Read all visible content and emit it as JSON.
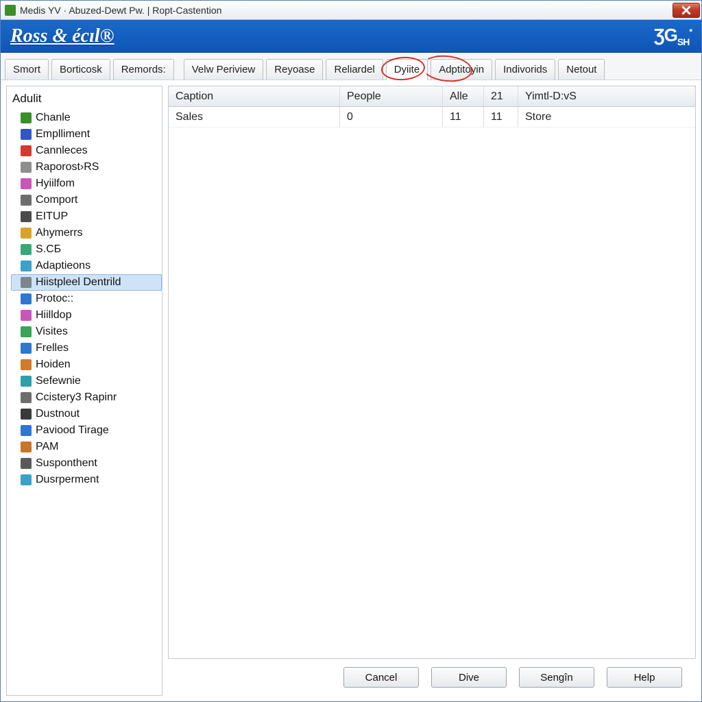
{
  "window": {
    "title": "Medis YV · Abuzed-Dewt Pw. | Ropt-Castention"
  },
  "brand": {
    "name": "Ross & écıl®",
    "logo_main": "ƷG",
    "logo_sub": "SH",
    "logo_star": "*"
  },
  "tabs": [
    {
      "label": "Smort"
    },
    {
      "label": "Borticosk"
    },
    {
      "label": "Remords:"
    },
    {
      "label": "Velw Periview"
    },
    {
      "label": "Reyoase"
    },
    {
      "label": "Reliardel"
    },
    {
      "label": "Dyiite",
      "circled": true
    },
    {
      "label": "Adptitoyin",
      "circled": true
    },
    {
      "label": "Indivorids"
    },
    {
      "label": "Netout"
    }
  ],
  "sidebar": {
    "header": "Adulit",
    "items": [
      {
        "label": "Chanle",
        "icon": "#3a8f2a"
      },
      {
        "label": "Emplliment",
        "icon": "#3057c2"
      },
      {
        "label": "Cannleces",
        "icon": "#d03a2f"
      },
      {
        "label": "Raporost›RS",
        "icon": "#8e8e8e"
      },
      {
        "label": "Hyiilfom",
        "icon": "#c957b9"
      },
      {
        "label": "Comport",
        "icon": "#6d6d6d"
      },
      {
        "label": "EITUP",
        "icon": "#4b4b4b"
      },
      {
        "label": "Ahymerrs",
        "icon": "#d9a22b"
      },
      {
        "label": "S.CБ",
        "icon": "#3aa779"
      },
      {
        "label": "Adaptieons",
        "icon": "#3aa2c9"
      },
      {
        "label": "Hiistpleel Dentrild",
        "icon": "#7d868f",
        "selected": true
      },
      {
        "label": "Protoc::",
        "icon": "#2f77d0"
      },
      {
        "label": "Hiilldop",
        "icon": "#c957b9"
      },
      {
        "label": "Visites",
        "icon": "#39a35a"
      },
      {
        "label": "Frelles",
        "icon": "#2f77d0"
      },
      {
        "label": "Hoiden",
        "icon": "#d07a2b"
      },
      {
        "label": "Sefewnie",
        "icon": "#2f9fae"
      },
      {
        "label": "Ccistery3 Rapinr",
        "icon": "#6d6d6d"
      },
      {
        "label": "Dustnout",
        "icon": "#3a3a3a"
      },
      {
        "label": "Paviood Tirage",
        "icon": "#2f77d0"
      },
      {
        "label": "PAM",
        "icon": "#c9742b"
      },
      {
        "label": "Susponthent",
        "icon": "#5a5a5a"
      },
      {
        "label": "Dusrperment",
        "icon": "#3aa2c9"
      }
    ]
  },
  "grid": {
    "columns": [
      "Caption",
      "People",
      "Alle",
      "21",
      "Yimtl-D:vS"
    ],
    "rows": [
      {
        "caption": "Sales",
        "people": "0",
        "alle": "11",
        "c21": "11",
        "yimtl": "Store"
      }
    ]
  },
  "footer": {
    "cancel": "Cancel",
    "dive": "Dive",
    "sengin": "Sengîn",
    "help": "Help"
  }
}
